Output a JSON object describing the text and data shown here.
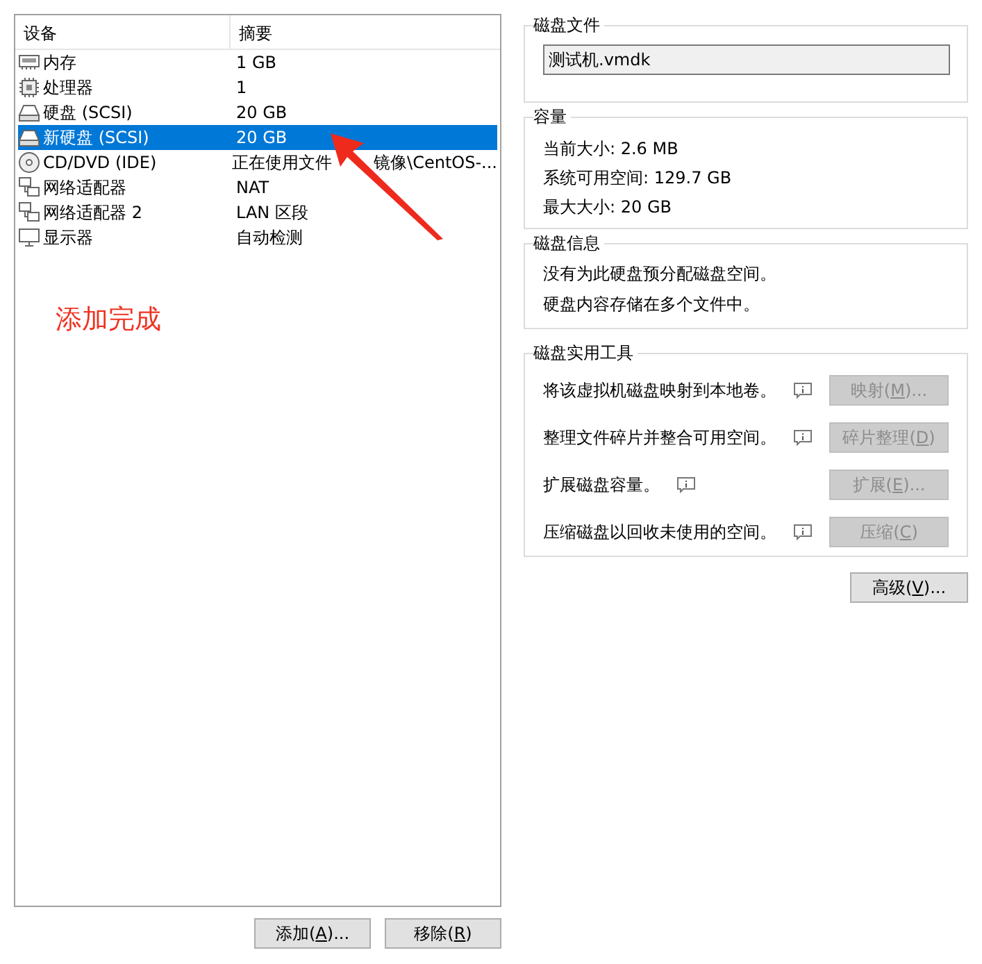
{
  "devices": {
    "columns": [
      "设备",
      "摘要"
    ],
    "rows": [
      {
        "kind": "memory",
        "name": "内存",
        "summary": "1 GB",
        "selected": false
      },
      {
        "kind": "cpu",
        "name": "处理器",
        "summary": "1",
        "selected": false
      },
      {
        "kind": "disk",
        "name": "硬盘 (SCSI)",
        "summary": "20 GB",
        "selected": false
      },
      {
        "kind": "disk",
        "name": "新硬盘 (SCSI)",
        "summary": "20 GB",
        "selected": true
      },
      {
        "kind": "cdrom",
        "name": "CD/DVD (IDE)",
        "summary": "正在使用文件",
        "summary_tail": "镜像\\CentOS-...",
        "selected": false
      },
      {
        "kind": "network",
        "name": "网络适配器",
        "summary": "NAT",
        "selected": false
      },
      {
        "kind": "network",
        "name": "网络适配器 2",
        "summary": "LAN 区段",
        "selected": false
      },
      {
        "kind": "display",
        "name": "显示器",
        "summary": "自动检测",
        "selected": false
      }
    ]
  },
  "annotation": "添加完成",
  "device_buttons": [
    {
      "before": "添加(",
      "key": "A",
      "after": ")...",
      "disabled": false
    },
    {
      "before": "移除(",
      "key": "R",
      "after": ")",
      "disabled": false
    }
  ],
  "disk_file": {
    "title": "磁盘文件",
    "value": "测试机.vmdk"
  },
  "capacity": {
    "title": "容量",
    "lines": [
      "当前大小: 2.6 MB",
      "系统可用空间: 129.7 GB",
      "最大大小: 20 GB"
    ]
  },
  "disk_info": {
    "title": "磁盘信息",
    "lines": [
      "没有为此硬盘预分配磁盘空间。",
      "硬盘内容存储在多个文件中。"
    ]
  },
  "utilities": {
    "title": "磁盘实用工具",
    "items": [
      {
        "text": "将该虚拟机磁盘映射到本地卷。",
        "button": {
          "before": "映射(",
          "key": "M",
          "after": ")...",
          "disabled": true
        }
      },
      {
        "text": "整理文件碎片并整合可用空间。",
        "button": {
          "before": "碎片整理(",
          "key": "D",
          "after": ")",
          "disabled": true
        }
      },
      {
        "text": "扩展磁盘容量。",
        "button": {
          "before": "扩展(",
          "key": "E",
          "after": ")...",
          "disabled": true
        }
      },
      {
        "text": "压缩磁盘以回收未使用的空间。",
        "button": {
          "before": "压缩(",
          "key": "C",
          "after": ")",
          "disabled": true
        }
      }
    ]
  },
  "advanced_button": {
    "before": "高级(",
    "key": "V",
    "after": ")...",
    "disabled": false
  }
}
